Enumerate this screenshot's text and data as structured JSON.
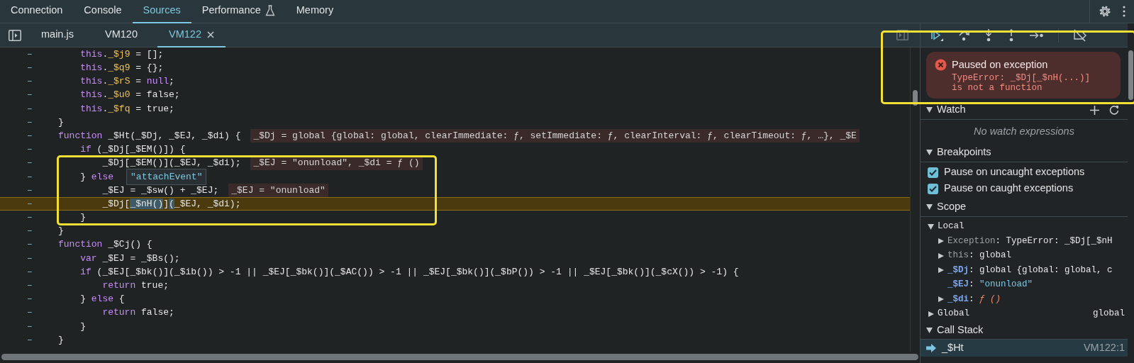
{
  "top_tabs": [
    {
      "label": "Connection",
      "selected": false,
      "experimental": false
    },
    {
      "label": "Console",
      "selected": false,
      "experimental": false
    },
    {
      "label": "Sources",
      "selected": true,
      "experimental": false
    },
    {
      "label": "Performance",
      "selected": false,
      "experimental": true
    },
    {
      "label": "Memory",
      "selected": false,
      "experimental": false
    }
  ],
  "file_tabs": [
    {
      "label": "main.js",
      "selected": false,
      "closable": false
    },
    {
      "label": "VM120",
      "selected": false,
      "closable": false
    },
    {
      "label": "VM122",
      "selected": true,
      "closable": true
    }
  ],
  "code_blocks": [
    {
      "framed": false,
      "lines": [
        {
          "marker": "–",
          "paused": false,
          "tokens": [
            {
              "kind": "kw",
              "text": "    this"
            },
            {
              "kind": "text",
              "text": "."
            },
            {
              "kind": "prop",
              "text": "_$j9"
            },
            {
              "kind": "text",
              "text": " = [];"
            }
          ]
        },
        {
          "marker": "–",
          "paused": false,
          "tokens": [
            {
              "kind": "kw",
              "text": "    this"
            },
            {
              "kind": "text",
              "text": "."
            },
            {
              "kind": "prop",
              "text": "_$q9"
            },
            {
              "kind": "text",
              "text": " = {};"
            }
          ]
        },
        {
          "marker": "–",
          "paused": false,
          "tokens": [
            {
              "kind": "kw",
              "text": "    this"
            },
            {
              "kind": "text",
              "text": "."
            },
            {
              "kind": "prop",
              "text": "_$rS"
            },
            {
              "kind": "text",
              "text": " = "
            },
            {
              "kind": "kw",
              "text": "null"
            },
            {
              "kind": "text",
              "text": ";"
            }
          ]
        },
        {
          "marker": "–",
          "paused": false,
          "tokens": [
            {
              "kind": "kw",
              "text": "    this"
            },
            {
              "kind": "text",
              "text": "."
            },
            {
              "kind": "prop",
              "text": "_$u0"
            },
            {
              "kind": "text",
              "text": " = false;"
            }
          ]
        },
        {
          "marker": "–",
          "paused": false,
          "tokens": [
            {
              "kind": "kw",
              "text": "    this"
            },
            {
              "kind": "text",
              "text": "."
            },
            {
              "kind": "prop",
              "text": "_$fq"
            },
            {
              "kind": "text",
              "text": " = true;"
            }
          ]
        },
        {
          "marker": "–",
          "paused": false,
          "tokens": [
            {
              "kind": "text",
              "text": "}"
            }
          ]
        },
        {
          "marker": "–",
          "paused": false,
          "tokens": [
            {
              "kind": "kw",
              "text": "function"
            },
            {
              "kind": "text",
              "text": " _$Ht(_$Dj, _$EJ, _$di) {"
            }
          ],
          "inline_value": "_$Dj = global {global: global, clearImmediate: ƒ, setImmediate: ƒ, clearInterval: ƒ, clearTimeout: ƒ, …}, _$E"
        },
        {
          "marker": "–",
          "paused": false,
          "tokens": [
            {
              "kind": "kw",
              "text": "    if"
            },
            {
              "kind": "text",
              "text": " (_$Dj[_$EM()]) {"
            }
          ]
        }
      ]
    },
    {
      "framed": true,
      "lines": [
        {
          "marker": "–",
          "paused": false,
          "tokens": [
            {
              "kind": "text",
              "text": "        _$Dj[_$EM()](_$EJ, _$di);"
            }
          ],
          "inline_value": "_$EJ = \"onunload\", _$di = ƒ ()"
        },
        {
          "marker": "–",
          "paused": false,
          "tokens": [
            {
              "kind": "text",
              "text": "    } "
            },
            {
              "kind": "kw",
              "text": "else"
            }
          ],
          "tooltip": "\"attachEvent\""
        },
        {
          "marker": "–",
          "paused": false,
          "tokens": [
            {
              "kind": "text",
              "text": "        _$EJ = _$sw() + _$EJ;"
            }
          ],
          "inline_value": "_$EJ = \"onunload\""
        },
        {
          "marker": "–",
          "paused": true,
          "tokens": [
            {
              "kind": "text",
              "text": "        _$Dj["
            },
            {
              "kind": "sel",
              "text": "_$nH()"
            },
            {
              "kind": "text",
              "text": "]"
            },
            {
              "kind": "sel",
              "text": "("
            },
            {
              "kind": "text",
              "text": "_$EJ, _$di);"
            }
          ]
        },
        {
          "marker": "–",
          "paused": false,
          "tokens": [
            {
              "kind": "text",
              "text": "    }"
            }
          ]
        }
      ]
    },
    {
      "framed": false,
      "lines": [
        {
          "marker": "–",
          "paused": false,
          "tokens": [
            {
              "kind": "text",
              "text": "}"
            }
          ]
        },
        {
          "marker": "–",
          "paused": false,
          "tokens": [
            {
              "kind": "kw",
              "text": "function"
            },
            {
              "kind": "text",
              "text": " _$Cj() {"
            }
          ]
        },
        {
          "marker": "–",
          "paused": false,
          "tokens": [
            {
              "kind": "kw",
              "text": "    var"
            },
            {
              "kind": "text",
              "text": " _$EJ = _$Bs();"
            }
          ]
        },
        {
          "marker": "–",
          "paused": false,
          "tokens": [
            {
              "kind": "kw",
              "text": "    if"
            },
            {
              "kind": "text",
              "text": " (_$EJ[_$bk()](_$ib()) > -1 || _$EJ[_$bk()](_$AC()) > -1 || _$EJ[_$bk()](_$bP()) > -1 || _$EJ[_$bk()](_$cX()) > -1) {"
            }
          ]
        },
        {
          "marker": "–",
          "paused": false,
          "tokens": [
            {
              "kind": "kw",
              "text": "        return"
            },
            {
              "kind": "text",
              "text": " true;"
            }
          ]
        },
        {
          "marker": "–",
          "paused": false,
          "tokens": [
            {
              "kind": "text",
              "text": "    } "
            },
            {
              "kind": "kw",
              "text": "else"
            },
            {
              "kind": "text",
              "text": " {"
            }
          ]
        },
        {
          "marker": "–",
          "paused": false,
          "tokens": [
            {
              "kind": "kw",
              "text": "        return"
            },
            {
              "kind": "text",
              "text": " false;"
            }
          ]
        },
        {
          "marker": "–",
          "paused": false,
          "tokens": [
            {
              "kind": "text",
              "text": "    }"
            }
          ]
        },
        {
          "marker": "–",
          "paused": false,
          "tokens": [
            {
              "kind": "text",
              "text": "}"
            }
          ]
        }
      ]
    }
  ],
  "debugger": {
    "framed": true,
    "paused_banner": {
      "title": "Paused on exception",
      "message": "TypeError: _$Dj[_$nH(...)]\nis not a function"
    },
    "watch": {
      "title": "Watch",
      "expanded": true,
      "empty_text": "No watch expressions"
    },
    "breakpoints": {
      "title": "Breakpoints",
      "expanded": true,
      "items": [
        {
          "label": "Pause on uncaught exceptions",
          "checked": true
        },
        {
          "label": "Pause on caught exceptions",
          "checked": true
        }
      ]
    },
    "scope": {
      "title": "Scope",
      "expanded": true,
      "groups": [
        {
          "name": "Local",
          "expanded": true,
          "items": [
            {
              "name": "Exception",
              "internal": true,
              "separator": ": ",
              "value": "TypeError: _$Dj[_$nH",
              "kind": "object",
              "expanded": false
            },
            {
              "name": "this",
              "internal": true,
              "separator": ": ",
              "value": "global",
              "kind": "object",
              "expanded": false
            },
            {
              "name": "_$Dj",
              "internal": false,
              "separator": ": ",
              "value": "global {global: global, c",
              "kind": "object",
              "expanded": false
            },
            {
              "name": "_$EJ",
              "internal": false,
              "separator": ": ",
              "value": "\"onunload\"",
              "kind": "string"
            },
            {
              "name": "_$di",
              "internal": false,
              "separator": ": ",
              "value": "ƒ ()",
              "kind": "function",
              "expanded": false
            }
          ]
        },
        {
          "name": "Global",
          "expanded": false,
          "value": "global"
        }
      ]
    },
    "call_stack": {
      "title": "Call Stack",
      "expanded": true,
      "frames": [
        {
          "name": "_$Ht",
          "location": "VM122:1",
          "selected": true
        }
      ]
    }
  }
}
